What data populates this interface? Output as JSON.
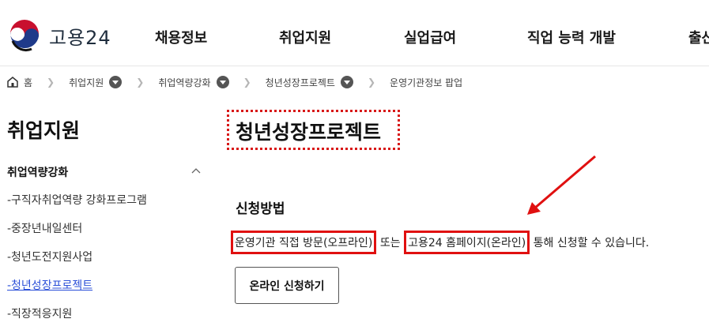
{
  "header": {
    "logo_text": "고용24",
    "nav": [
      "채용정보",
      "취업지원",
      "실업급여",
      "직업 능력 개발",
      "출산"
    ]
  },
  "breadcrumb": {
    "home": "홈",
    "items": [
      "취업지원",
      "취업역량강화",
      "청년성장프로젝트",
      "운영기관정보 팝업"
    ]
  },
  "sidebar": {
    "title": "취업지원",
    "group": "취업역량강화",
    "items": [
      "-구직자취업역량 강화프로그램",
      "-중장년내일센터",
      "-청년도전지원사업",
      "-청년성장프로젝트",
      "-직장적응지원"
    ],
    "active_index": 3
  },
  "main": {
    "title": "청년성장프로젝트",
    "section_title": "신청방법",
    "desc_part1": "운영기관 직접 방문(오프라인)",
    "desc_mid": " 또는 ",
    "desc_part2": "고용24 홈페이지(온라인)",
    "desc_end": " 통해 신청할 수 있습니다.",
    "apply_button": "온라인 신청하기"
  },
  "colors": {
    "highlight": "#e01010",
    "active_link": "#2b4fd8"
  }
}
